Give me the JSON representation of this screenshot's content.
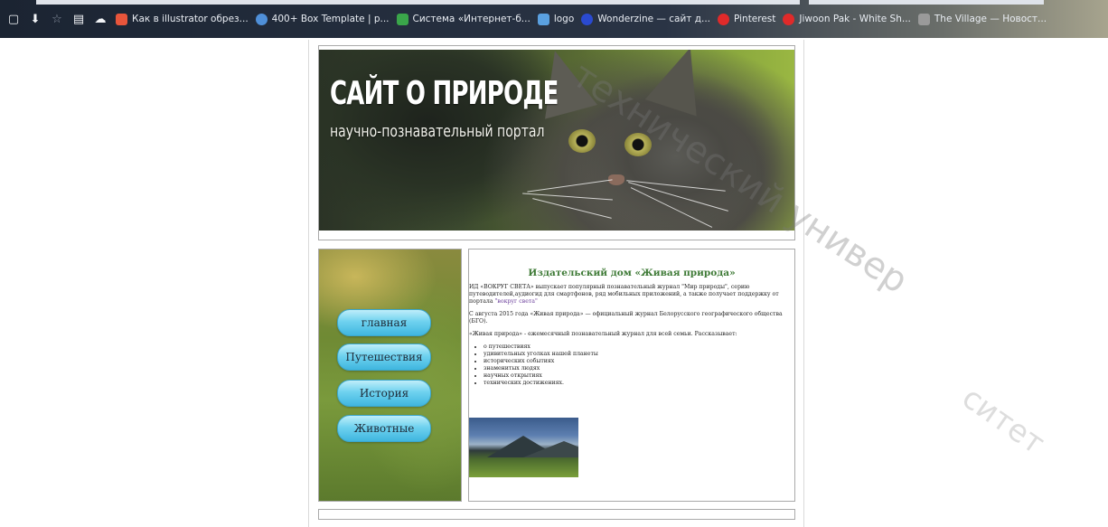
{
  "bookmarks": {
    "items": [
      {
        "label": "Как в illustrator обрез...",
        "color": "#e8553b"
      },
      {
        "label": "400+ Box Template | p...",
        "color": "#4f8fd8"
      },
      {
        "label": "Система «Интернет-б...",
        "color": "#3aa64a"
      },
      {
        "label": "logo",
        "color": "#5aa0e0"
      },
      {
        "label": "Wonderzine — сайт д...",
        "color": "#2a4ad0"
      },
      {
        "label": "Pinterest",
        "color": "#e02a2a"
      },
      {
        "label": "Jiwoon Pak - White Sh...",
        "color": "#e02a2a"
      },
      {
        "label": "The Village — Новост...",
        "color": "#9a9a9a"
      }
    ]
  },
  "header": {
    "title": "САЙТ О ПРИРОДЕ",
    "subtitle": "научно-познавательный портал"
  },
  "nav": {
    "items": [
      "главная",
      "Путешествия",
      "История",
      "Животные"
    ]
  },
  "content": {
    "title": "Издательский дом «Живая природа»",
    "p1_before": "ИД «ВОКРУГ СВЕТА» выпускает популярный познавательный журнал \"Мир природы\", серию путеводителей,аудиогид для смартфонов, ряд мобильных приложений, а также получает поддержку от портала ",
    "p1_link": "\"вокруг света\"",
    "p2": "С августа 2015 года «Живая природа» — официальный журнал Белорусского географического общества (БГО).",
    "p3": "«Живая природа» - ежемесячный познавательный журнал для всей семьи. Рассказывает:",
    "list": [
      "о путешествиях",
      "удивительных уголках нашей планеты",
      "исторических событиях",
      "знаменитых людях",
      "научных открытиях",
      "технических достижениях."
    ]
  },
  "watermark": {
    "text1": "технический универ",
    "text2": "ситет"
  }
}
